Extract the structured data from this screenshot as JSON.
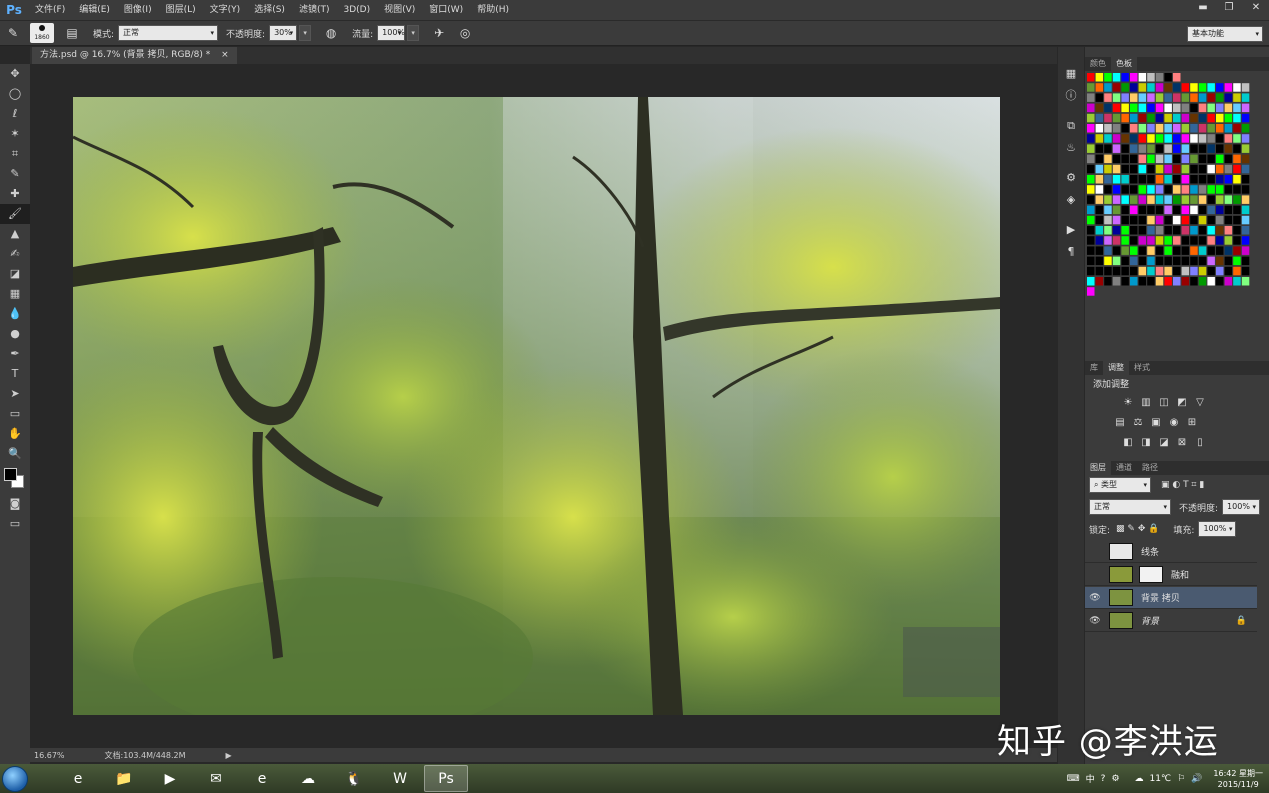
{
  "app": {
    "logo": "Ps",
    "menu": [
      "文件(F)",
      "编辑(E)",
      "图像(I)",
      "图层(L)",
      "文字(Y)",
      "选择(S)",
      "滤镜(T)",
      "3D(D)",
      "视图(V)",
      "窗口(W)",
      "帮助(H)"
    ],
    "window_controls": [
      "▬",
      "❐",
      "✕"
    ]
  },
  "options": {
    "brush_size": "1860",
    "mode_label": "模式:",
    "mode_value": "正常",
    "opacity_label": "不透明度:",
    "opacity_value": "30%",
    "flow_label": "流量:",
    "flow_value": "100%",
    "workspace": "基本功能"
  },
  "document": {
    "tab_label": "方法.psd @ 16.7% (背景 拷贝, RGB/8) *",
    "tab_close": "×",
    "zoom": "16.67%",
    "doc_info": "文档:103.4M/448.2M",
    "status_arrow": "▶"
  },
  "tools": [
    "move-icon",
    "ellipse-marquee-icon",
    "lasso-icon",
    "magic-wand-icon",
    "crop-icon",
    "eyedropper-icon",
    "healing-brush-icon",
    "brush-icon",
    "clone-stamp-icon",
    "history-brush-icon",
    "eraser-icon",
    "gradient-icon",
    "blur-icon",
    "dodge-icon",
    "pen-icon",
    "type-icon",
    "path-select-icon",
    "rectangle-icon",
    "hand-icon",
    "zoom-icon"
  ],
  "tool_glyphs": [
    "✥",
    "◯",
    "ℓ",
    "✶",
    "⌗",
    "✎",
    "✚",
    "🖌",
    "▲",
    "✍",
    "◪",
    "▦",
    "💧",
    "●",
    "✒",
    "T",
    "➤",
    "▭",
    "✋",
    "🔍"
  ],
  "active_tool_index": 7,
  "panels": {
    "color_tabs": [
      "颜色",
      "色板"
    ],
    "color_active": 1,
    "adjust_tabs": [
      "库",
      "调整",
      "样式"
    ],
    "adjust_active": 1,
    "adjust_title": "添加调整",
    "adjust_rows": [
      [
        "☀",
        "▥",
        "◫",
        "◩",
        "▽"
      ],
      [
        "▤",
        "⚖",
        "▣",
        "◉",
        "⊞"
      ],
      [
        "◧",
        "◨",
        "◪",
        "⊠",
        "▯"
      ]
    ],
    "layer_tabs": [
      "图层",
      "通道",
      "路径"
    ],
    "layer_active": 0,
    "filter_label": "类型",
    "blend_mode": "正常",
    "opacity_label": "不透明度:",
    "opacity_value": "100%",
    "lock_label": "锁定:",
    "fill_label": "填充:",
    "fill_value": "100%",
    "layers": [
      {
        "name": "线条",
        "visible": false,
        "selected": false
      },
      {
        "name": "融和",
        "visible": false,
        "selected": false
      },
      {
        "name": "背景 拷贝",
        "visible": true,
        "selected": true
      },
      {
        "name": "背景",
        "visible": true,
        "selected": false,
        "locked": true
      }
    ]
  },
  "side_icons": [
    "histogram-icon",
    "info-icon",
    "brush-preset-icon",
    "clone-source-icon",
    "properties-icon",
    "styles-icon",
    "actions-icon",
    "paragraph-icon"
  ],
  "side_glyphs": [
    "▦",
    "ⓘ",
    "⧉",
    "♨",
    "⚙",
    "◈",
    "▶",
    "¶"
  ],
  "watermark": "知乎 @李洪运",
  "taskbar": {
    "apps": [
      "ie-icon",
      "explorer-icon",
      "media-player-icon",
      "outlook-icon",
      "ie-icon",
      "cloud-icon",
      "qq-icon",
      "word-icon",
      "photoshop-icon"
    ],
    "app_glyphs": [
      "e",
      "📁",
      "▶",
      "✉",
      "e",
      "☁",
      "🐧",
      "W",
      "Ps"
    ],
    "active_app_index": 8,
    "ime": "中",
    "temperature": "11℃",
    "time": "16:42 星期一",
    "date": "2015/11/9"
  }
}
